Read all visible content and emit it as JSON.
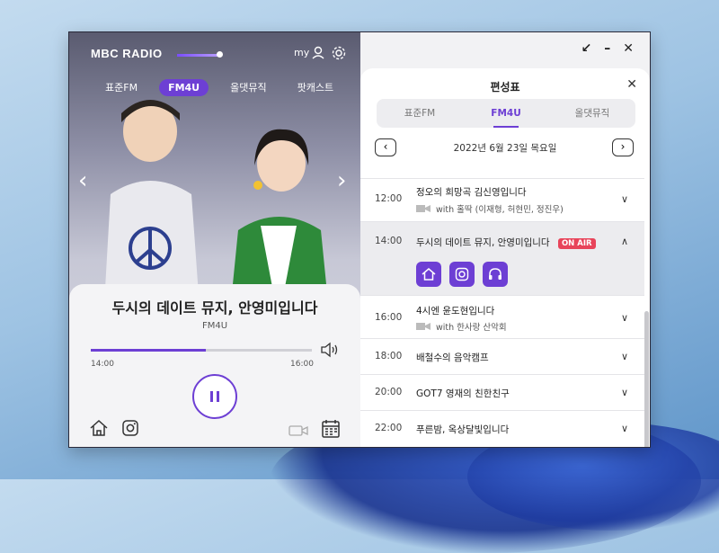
{
  "app": {
    "logo": "MBC RADIO",
    "my_label": "my",
    "channels": [
      "표준FM",
      "FM4U",
      "올댓뮤직",
      "팟캐스트"
    ],
    "active_channel": "FM4U"
  },
  "now_playing": {
    "title": "두시의 데이트 뮤지, 안영미입니다",
    "channel": "FM4U",
    "start_time": "14:00",
    "end_time": "16:00",
    "progress_fraction": 0.52
  },
  "schedule": {
    "title": "편성표",
    "tabs": [
      "표준FM",
      "FM4U",
      "올댓뮤직"
    ],
    "active_tab": "FM4U",
    "date": "2022년 6월 23일 목요일",
    "onair_label": "ON AIR",
    "items": [
      {
        "time": "12:00",
        "name": "정오의 희망곡 김신영입니다",
        "sub": "with 홀딱 (이재형, 허현민, 정진우)"
      },
      {
        "time": "14:00",
        "name": "두시의 데이트 뮤지, 안영미입니다",
        "sub": ""
      },
      {
        "time": "16:00",
        "name": "4시엔 윤도현입니다",
        "sub": "with 한사랑 산악회"
      },
      {
        "time": "18:00",
        "name": "배철수의 음악캠프",
        "sub": ""
      },
      {
        "time": "20:00",
        "name": "GOT7 영재의 친한친구",
        "sub": ""
      },
      {
        "time": "22:00",
        "name": "푸른밤, 옥상달빛입니다",
        "sub": ""
      }
    ]
  },
  "colors": {
    "accent": "#6d3fd4",
    "onair": "#e8445a"
  }
}
